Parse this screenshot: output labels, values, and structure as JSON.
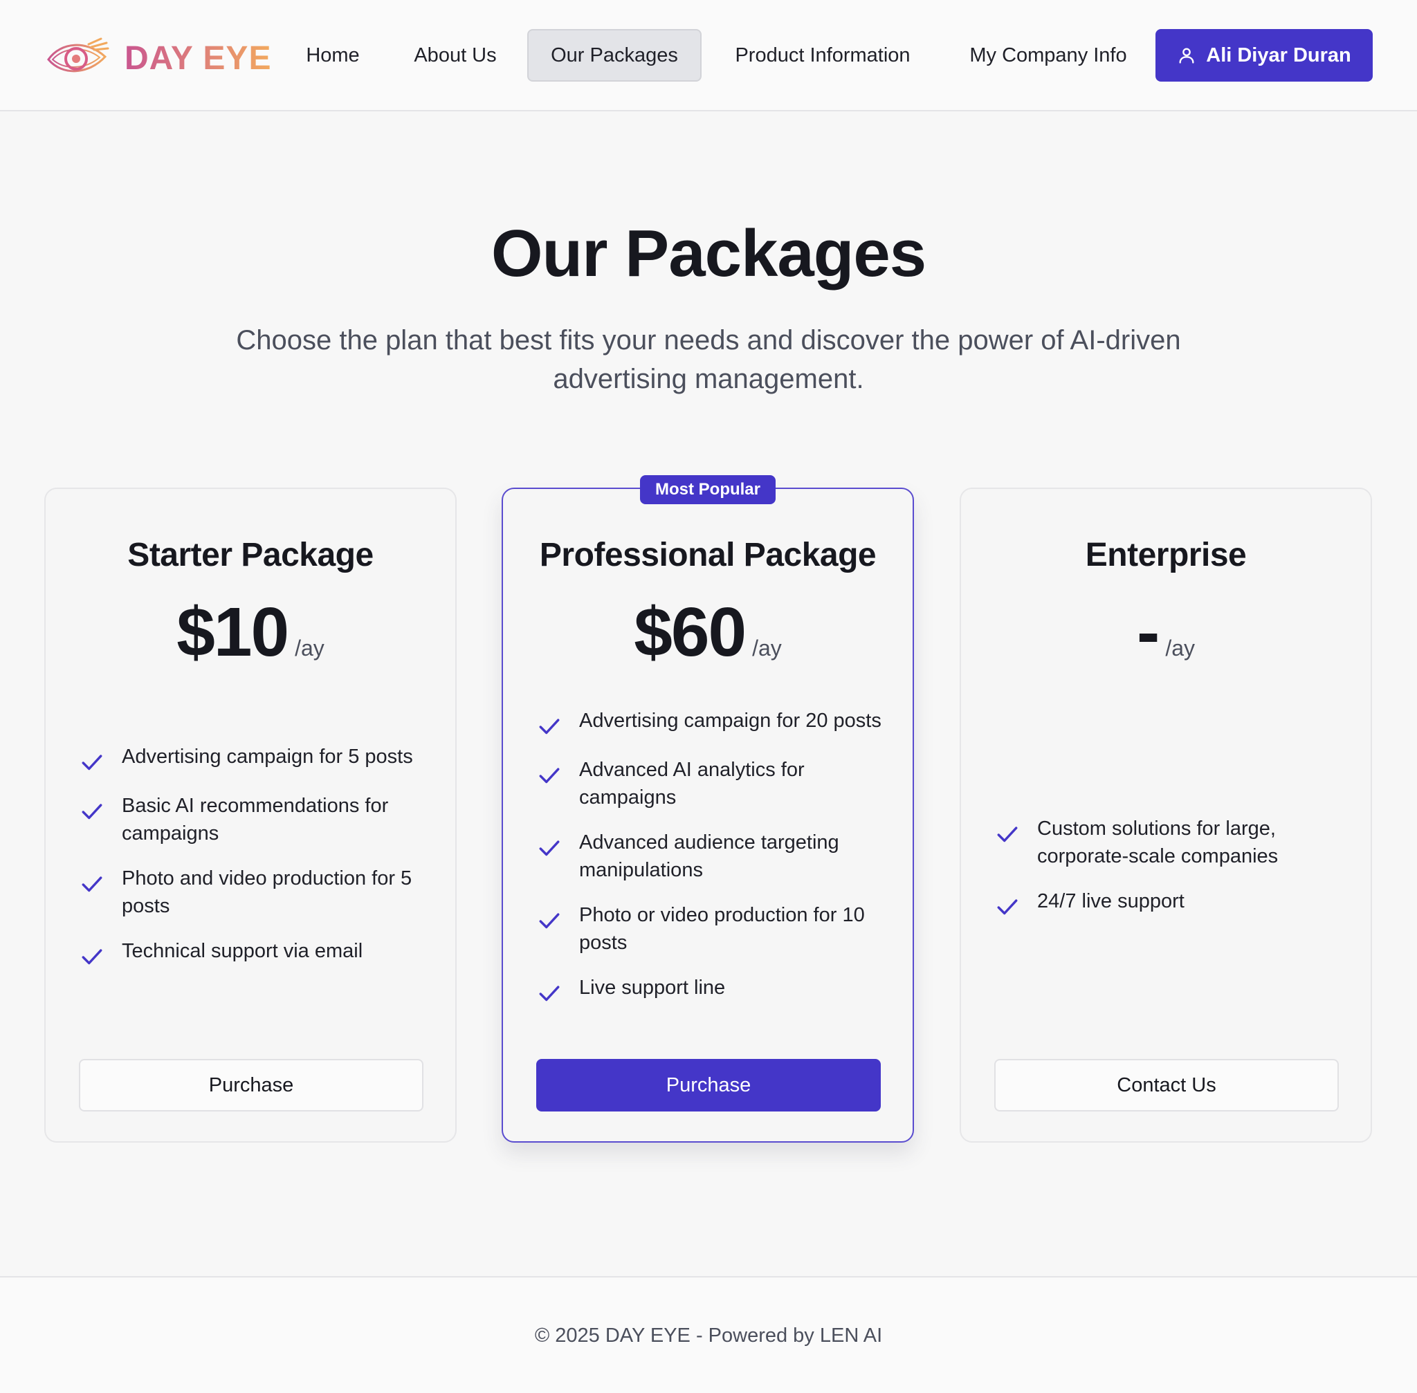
{
  "brand": {
    "name": "DAY EYE",
    "logo_icon": "eye-logo-icon"
  },
  "nav": {
    "items": [
      {
        "label": "Home"
      },
      {
        "label": "About Us"
      },
      {
        "label": "Our Packages",
        "active": true
      },
      {
        "label": "Product Information"
      },
      {
        "label": "My Company Info"
      }
    ],
    "user": {
      "name": "Ali Diyar Duran",
      "icon": "user-icon"
    }
  },
  "hero": {
    "title": "Our Packages",
    "subtitle_line1": "Choose the plan that best fits your needs and discover the power of AI-driven",
    "subtitle_line2": "advertising management."
  },
  "packages": [
    {
      "name": "Starter Package",
      "price": "$10",
      "period": "/ay",
      "features": [
        "Advertising campaign for 5 posts",
        "Basic AI recommendations for campaigns",
        "Photo and video production for 5 posts",
        "Technical support via email"
      ],
      "button": "Purchase"
    },
    {
      "name": "Professional Package",
      "badge": "Most Popular",
      "price": "$60",
      "period": "/ay",
      "features": [
        "Advertising campaign for 20 posts",
        "Advanced AI analytics for campaigns",
        "Advanced audience targeting manipulations",
        "Photo or video production for 10 posts",
        "Live support line"
      ],
      "button": "Purchase"
    },
    {
      "name": "Enterprise",
      "price": "-",
      "period": "/ay",
      "features": [
        "Custom solutions for large, corporate-scale companies",
        "24/7 live support"
      ],
      "button": "Contact Us"
    }
  ],
  "footer": {
    "text": "© 2025 DAY EYE - Powered by LEN AI"
  },
  "colors": {
    "accent": "#4436c8",
    "background": "#f7f7f7",
    "logo_gradient": [
      "#c9568f",
      "#f2a95e"
    ]
  }
}
